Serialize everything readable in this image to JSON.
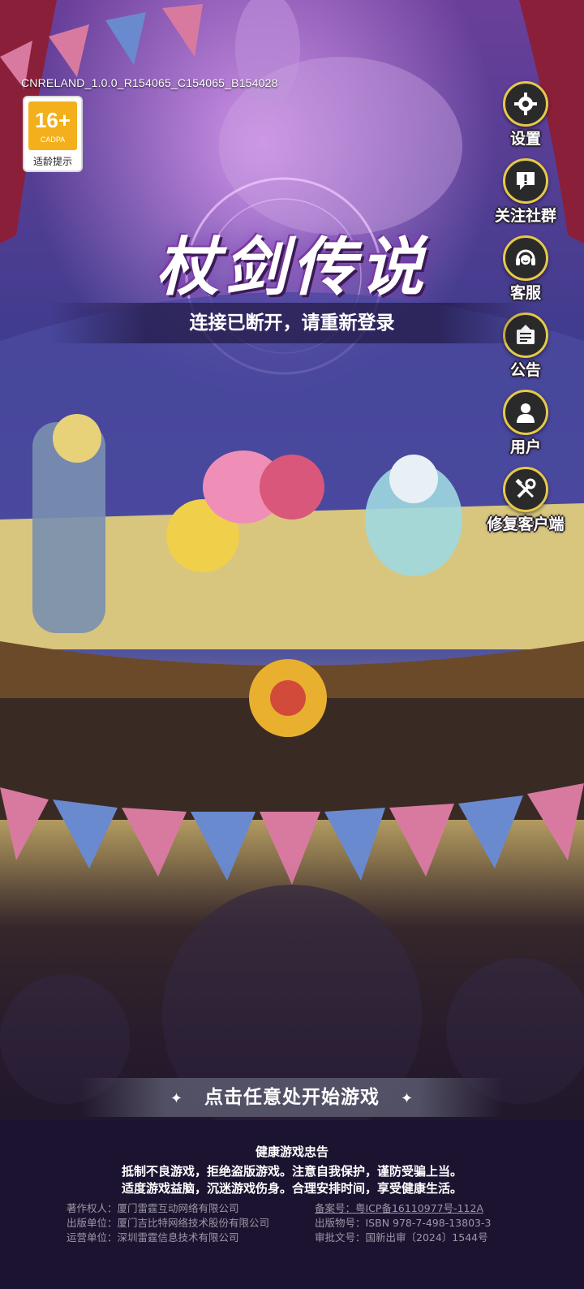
{
  "version_text": "CNRELAND_1.0.0_R154065_C154065_B154028",
  "age_rating": {
    "number": "16+",
    "org": "CADPA",
    "tip": "适龄提示"
  },
  "side_menu": [
    {
      "label": "设置",
      "icon": "gear-icon"
    },
    {
      "label": "关注社群",
      "icon": "exclamation-bubble-icon"
    },
    {
      "label": "客服",
      "icon": "headset-icon"
    },
    {
      "label": "公告",
      "icon": "notice-board-icon"
    },
    {
      "label": "用户",
      "icon": "user-icon"
    },
    {
      "label": "修复客户端",
      "icon": "repair-tools-icon"
    }
  ],
  "logo_text": "杖剑传说",
  "disconnect_message": "连接已断开，请重新登录",
  "start_prompt": "点击任意处开始游戏",
  "health_notice": {
    "title": "健康游戏忠告",
    "line1": "抵制不良游戏，拒绝盗版游戏。注意自我保护，谨防受骗上当。",
    "line2": "适度游戏益脑，沉迷游戏伤身。合理安排时间，享受健康生活。"
  },
  "credits": {
    "copyright": "著作权人：厦门雷霆互动网络有限公司",
    "publisher": "出版单位：厦门吉比特网络技术股份有限公司",
    "operator": "运营单位：深圳雷霆信息技术有限公司",
    "icp": "备案号：粤ICP备16110977号-112A",
    "isbn": "出版物号：ISBN 978-7-498-13803-3",
    "approval": "审批文号：国新出审〔2024〕1544号"
  },
  "colors": {
    "button_ring": "#e6c84a",
    "button_fill": "#2a2a2a",
    "age_badge": "#f3b01c"
  }
}
